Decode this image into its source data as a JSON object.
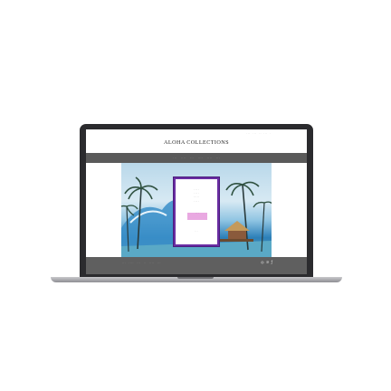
{
  "site": {
    "logo_text": "ALOHA COLLECTIONS",
    "utility_links": [
      "· · ·",
      "· · ·",
      "· ·",
      "· · ·",
      "·"
    ],
    "nav_items": [
      "· · ·",
      "· · · ·",
      "· · ·",
      "· · · ·",
      "· · · ·",
      "· · ·"
    ]
  },
  "popup": {
    "lines": [
      "· · · ·",
      "· · · ·",
      "· · · · ·",
      "· · · ·"
    ],
    "button_label": "· · ·",
    "footer_text": "· · ·"
  },
  "footer": {
    "links": [
      "· · ·",
      "· · · ·",
      "· · ·",
      "· ·",
      "· · · ·",
      "· · ·"
    ],
    "social_icons": [
      "instagram-icon",
      "pinterest-icon",
      "facebook-icon"
    ]
  },
  "colors": {
    "navbar": "#5a5a5a",
    "footer": "#5f5f5f",
    "popup_border": "#6a2da3",
    "popup_button": "#e9a9e1",
    "laptop_bezel": "#2b2b2e"
  }
}
